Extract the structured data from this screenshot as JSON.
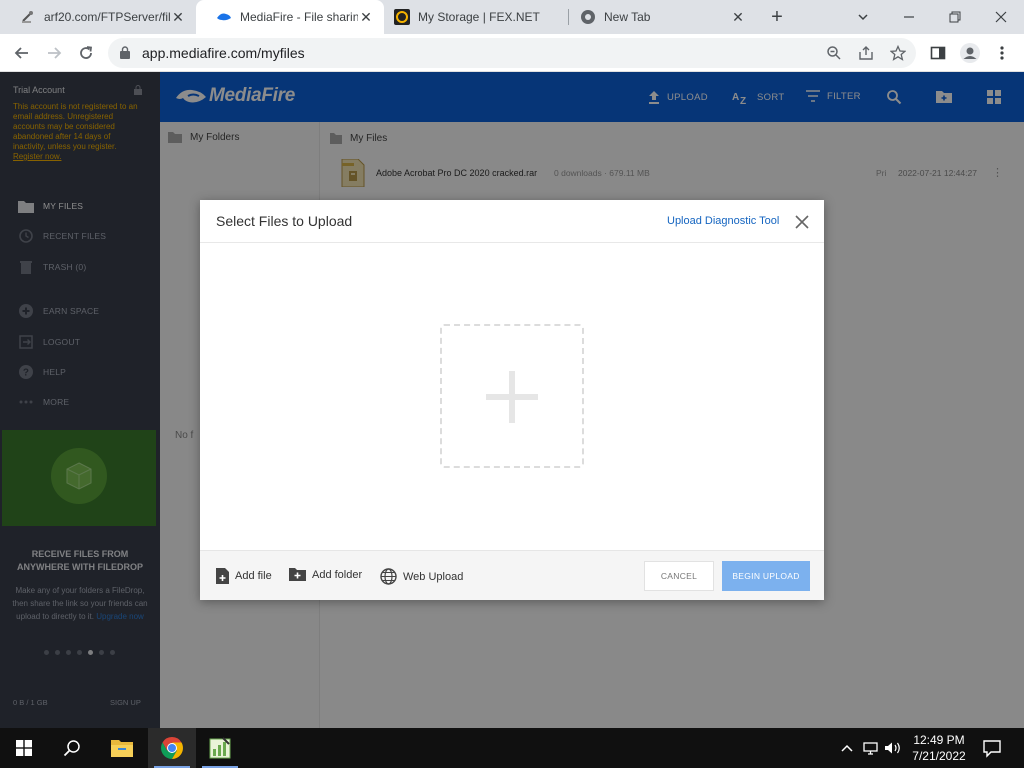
{
  "browser": {
    "tabs": [
      {
        "title": "arf20.com/FTPServer/fil",
        "icon": "ftp-favicon"
      },
      {
        "title": "MediaFire - File sharing",
        "icon": "mediafire-favicon"
      },
      {
        "title": "My Storage | FEX.NET",
        "icon": "fex-favicon"
      },
      {
        "title": "New Tab",
        "icon": "chrome-favicon"
      }
    ],
    "url": "app.mediafire.com/myfiles"
  },
  "sidebar": {
    "trial_title": "Trial Account",
    "trial_text": "This account is not registered to an email address. Unregistered accounts may be considered abandoned after 14 days of inactivity, unless you register.",
    "register_link": "Register now.",
    "nav": [
      {
        "label": "MY FILES",
        "icon": "folder-icon"
      },
      {
        "label": "RECENT FILES",
        "icon": "clock-icon"
      },
      {
        "label": "TRASH (0)",
        "icon": "trash-icon"
      },
      {
        "label": "EARN SPACE",
        "icon": "plus-circle-icon"
      },
      {
        "label": "LOGOUT",
        "icon": "logout-icon"
      },
      {
        "label": "HELP",
        "icon": "help-icon"
      },
      {
        "label": "MORE",
        "icon": "more-icon"
      }
    ],
    "promo_title": "RECEIVE FILES FROM ANYWHERE WITH FILEDROP",
    "promo_text": "Make any of your folders a FileDrop, then share the link so your friends can upload to directly to it.",
    "promo_link": "Upgrade now",
    "storage": "0 B / 1 GB",
    "signup": "SIGN UP"
  },
  "topbar": {
    "logo": "MediaFire",
    "actions": [
      {
        "label": "UPLOAD",
        "icon": "upload-icon"
      },
      {
        "label": "SORT",
        "icon": "sort-az-icon"
      },
      {
        "label": "FILTER",
        "icon": "filter-icon"
      }
    ]
  },
  "folders_pane": {
    "title": "My Folders",
    "hint": "No f"
  },
  "files_pane": {
    "title": "My Files",
    "files": [
      {
        "name": "Adobe Acrobat Pro DC 2020 cracked.rar",
        "meta": "0 downloads · 679.11 MB",
        "privacy": "Pri",
        "date": "2022-07-21 12:44:27"
      }
    ]
  },
  "modal": {
    "title": "Select Files to Upload",
    "diagnostic_link": "Upload Diagnostic Tool",
    "add_file": "Add file",
    "add_folder": "Add folder",
    "web_upload": "Web Upload",
    "cancel": "CANCEL",
    "begin": "BEGIN UPLOAD"
  },
  "taskbar": {
    "time": "12:49 PM",
    "date": "7/21/2022"
  },
  "colors": {
    "mediafire_blue": "#0c61d9",
    "sidebar": "#3a3f4b",
    "warning": "#f6b300",
    "begin_upload": "#7cb1ee",
    "link": "#1565c0"
  }
}
